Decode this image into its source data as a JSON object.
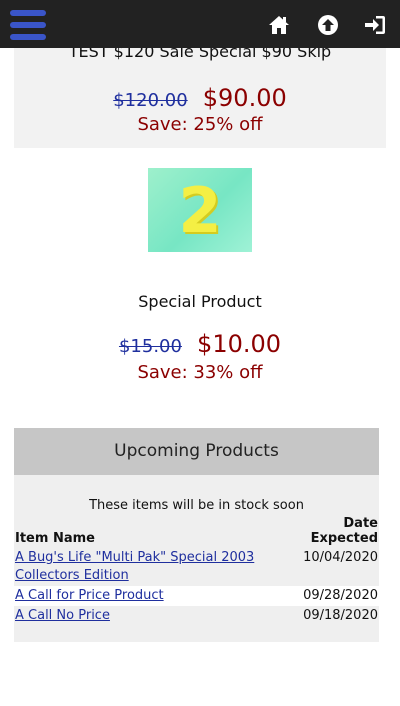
{
  "header": {
    "icons": [
      "menu-icon",
      "home-icon",
      "up-arrow-icon",
      "sign-in-icon"
    ],
    "accent": "#3a55c9",
    "bar_color": "#222222"
  },
  "products": [
    {
      "name": "TEST $120 Sale Special $90 Skip",
      "old_price": "$120.00",
      "new_price": "$90.00",
      "save": "Save: 25% off"
    },
    {
      "thumb_text": "2",
      "name": "Special Product",
      "old_price": "$15.00",
      "new_price": "$10.00",
      "save": "Save: 33% off"
    }
  ],
  "upcoming": {
    "title": "Upcoming Products",
    "note": "These items will be in stock soon",
    "columns": {
      "name": "Item Name",
      "date": "Date Expected"
    },
    "rows": [
      {
        "name": "A Bug's Life \"Multi Pak\" Special 2003 Collectors Edition",
        "date": "10/04/2020"
      },
      {
        "name": "A Call for Price Product",
        "date": "09/28/2020"
      },
      {
        "name": "A Call No Price",
        "date": "09/18/2020"
      }
    ]
  },
  "colors": {
    "sale_price": "#8b0000",
    "old_price": "#1f2f9e",
    "link": "#1f2f9e"
  }
}
